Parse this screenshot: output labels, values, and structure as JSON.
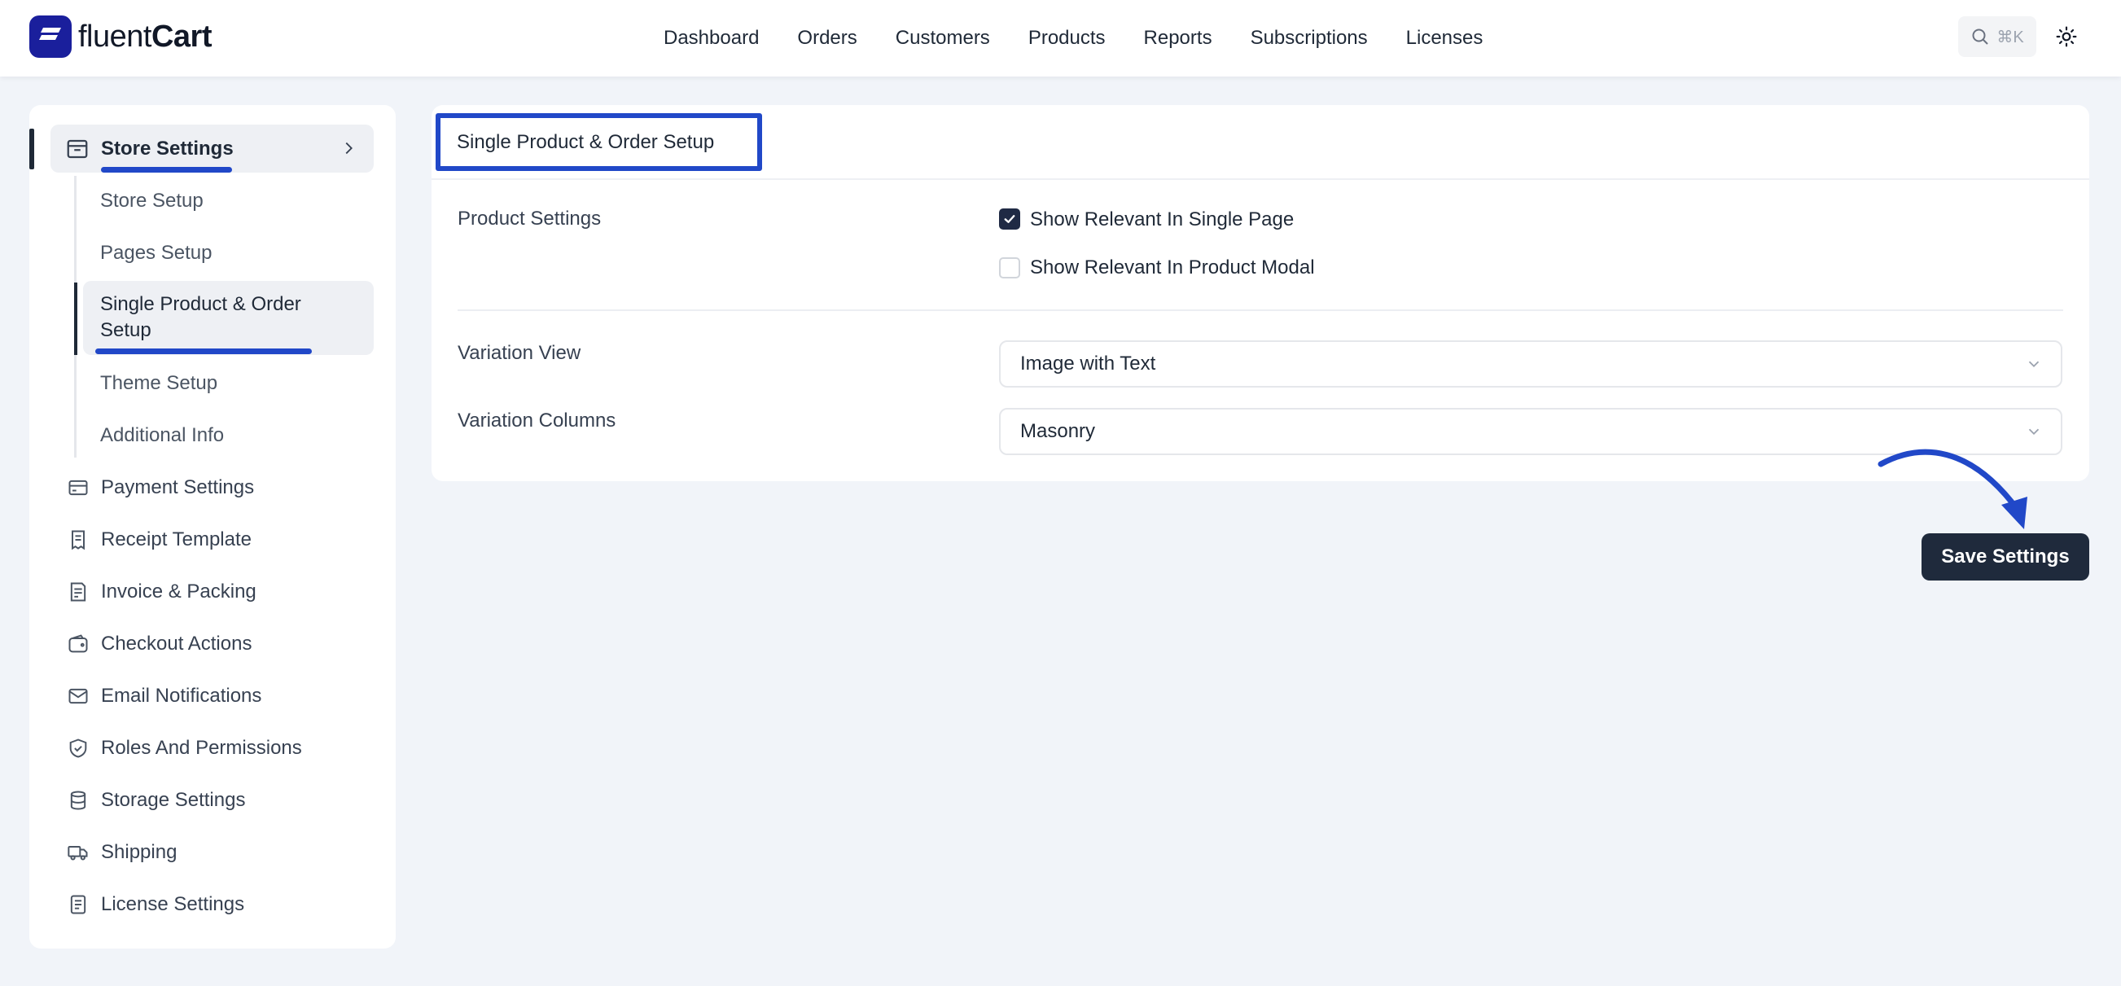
{
  "app": {
    "logo_prefix": "fluent",
    "logo_suffix": "Cart"
  },
  "nav": {
    "items": [
      "Dashboard",
      "Orders",
      "Customers",
      "Products",
      "Reports",
      "Subscriptions",
      "Licenses"
    ]
  },
  "search": {
    "shortcut": "⌘K"
  },
  "sidebar": {
    "parent": {
      "label": "Store Settings",
      "icon": "store-icon"
    },
    "sub_items": [
      "Store Setup",
      "Pages Setup",
      "Single Product & Order Setup",
      "Theme Setup",
      "Additional Info"
    ],
    "active_sub_item": "Single Product & Order Setup",
    "items": [
      {
        "label": "Payment Settings",
        "icon": "credit-card-icon"
      },
      {
        "label": "Receipt Template",
        "icon": "receipt-icon"
      },
      {
        "label": "Invoice & Packing",
        "icon": "invoice-icon"
      },
      {
        "label": "Checkout Actions",
        "icon": "wallet-icon"
      },
      {
        "label": "Email Notifications",
        "icon": "mail-icon"
      },
      {
        "label": "Roles And Permissions",
        "icon": "shield-check-icon"
      },
      {
        "label": "Storage Settings",
        "icon": "database-icon"
      },
      {
        "label": "Shipping",
        "icon": "truck-icon"
      },
      {
        "label": "License Settings",
        "icon": "document-icon"
      }
    ]
  },
  "main": {
    "tab_title": "Single Product & Order Setup",
    "product_settings": {
      "label": "Product Settings",
      "options": [
        {
          "label": "Show Relevant In Single Page",
          "checked": true
        },
        {
          "label": "Show Relevant In Product Modal",
          "checked": false
        }
      ]
    },
    "variation_view": {
      "label": "Variation View",
      "value": "Image with Text"
    },
    "variation_columns": {
      "label": "Variation Columns",
      "value": "Masonry"
    },
    "save_label": "Save Settings"
  },
  "colors": {
    "accent": "#2148c8",
    "brand": "#1a1f9c",
    "button": "#1f2a3c",
    "background": "#f1f4f9"
  }
}
